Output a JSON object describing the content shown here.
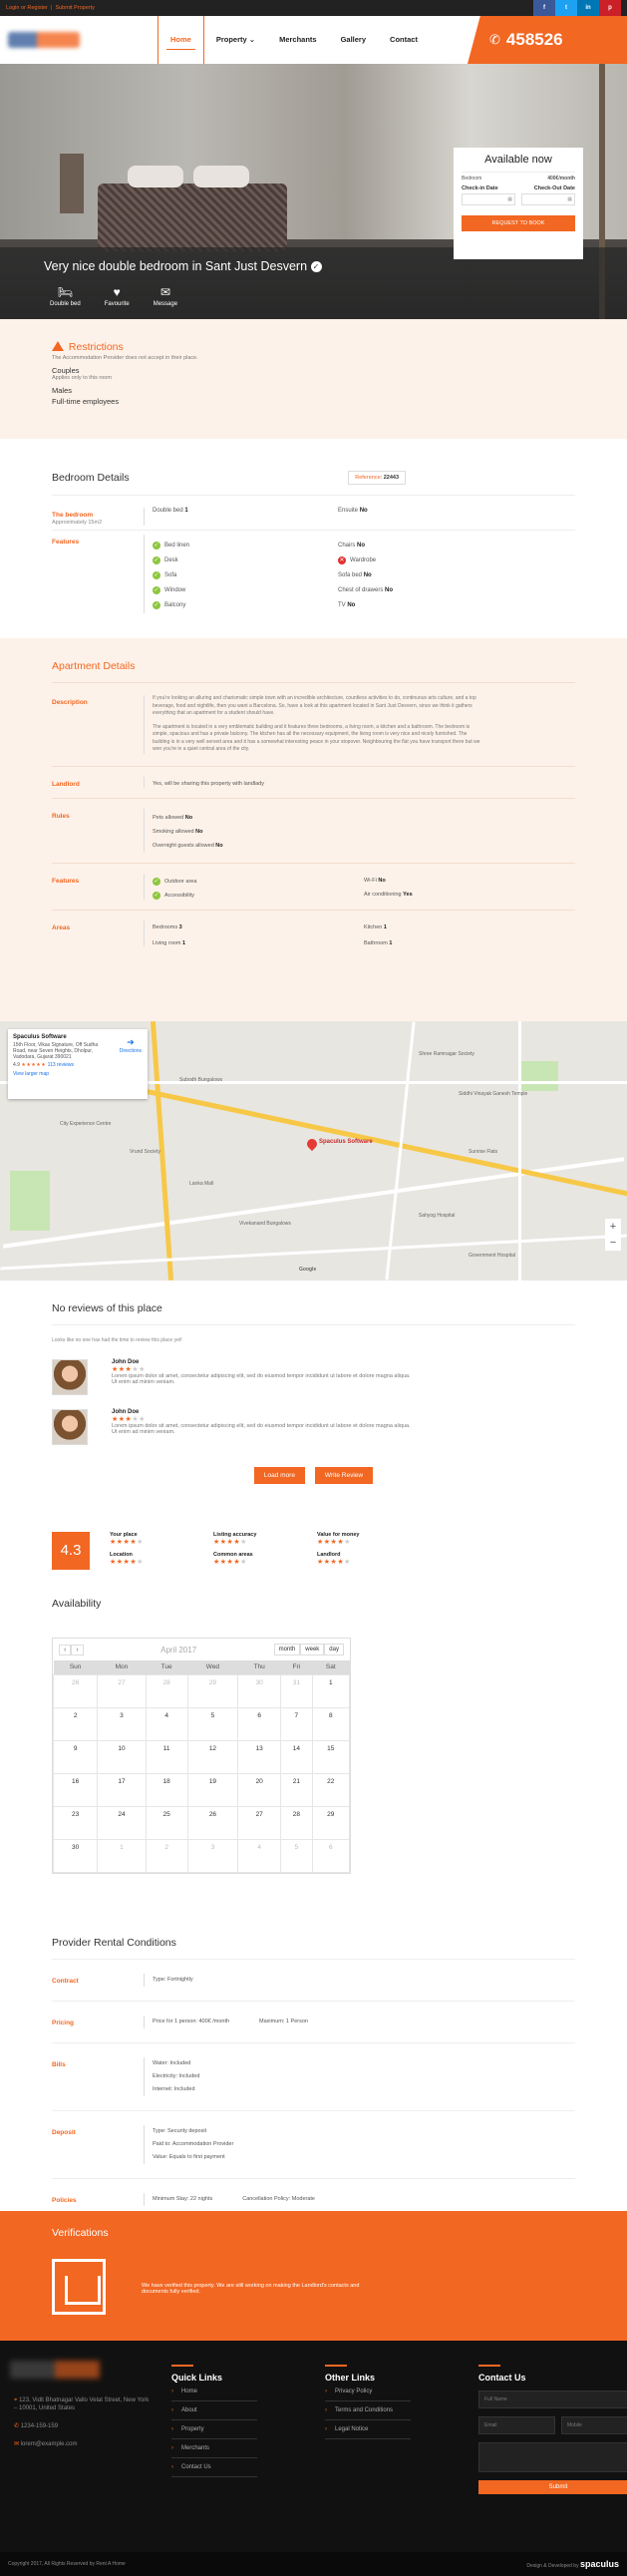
{
  "topbar": {
    "login": "Login or Register",
    "submit": "Submit Property",
    "social": [
      "f",
      "t",
      "in",
      "p"
    ]
  },
  "nav": {
    "items": [
      "Home",
      "Property",
      "Merchants",
      "Gallery",
      "Contact"
    ],
    "phone": "458526"
  },
  "hero": {
    "title": "Very nice double bedroom in Sant Just Desvern",
    "features": [
      "Double bed",
      "Favourite",
      "Message"
    ]
  },
  "booking": {
    "title": "Available now",
    "bedroom_label": "Bedroom",
    "price": "400€/month",
    "checkin": "Check-in Date",
    "checkout": "Check-Out Date",
    "button": "REQUEST TO BOOK"
  },
  "restrictions": {
    "title": "Restrictions",
    "note": "The Accommodation Provider does not accept in their place.",
    "items": [
      {
        "title": "Couples",
        "sub": "Applies only to this room"
      },
      {
        "title": "Males",
        "sub": ""
      },
      {
        "title": "Full-time employees",
        "sub": ""
      }
    ]
  },
  "bedroom": {
    "title": "Bedroom Details",
    "reference_label": "Reference",
    "reference": "22443",
    "room_label": "The bedroom",
    "room_sub": "Approximately 15m2",
    "bed_label": "Double bed",
    "bed_value": "1",
    "ensuite_label": "Ensuite",
    "ensuite_value": "No",
    "features_label": "Features",
    "features_left": [
      "Bed linen",
      "Desk",
      "Sofa",
      "Window",
      "Balcony"
    ],
    "features_right": [
      {
        "label": "Chairs",
        "value": "No",
        "state": "none"
      },
      {
        "label": "Wardrobe",
        "value": "",
        "state": "x"
      },
      {
        "label": "Sofa bed",
        "value": "No",
        "state": "none"
      },
      {
        "label": "Chest of drawers",
        "value": "No",
        "state": "none"
      },
      {
        "label": "TV",
        "value": "No",
        "state": "none"
      }
    ]
  },
  "apartment": {
    "title": "Apartment Details",
    "description_label": "Description",
    "description_1": "If you're looking an alluring and charismatic simple town with an incredible architecture, countless activities to do, continuous arts culture, and a top beverage, food and nightlife, then you want a Barcelona. So, have a look at this apartment located in Sant Just Desvern, since we think it gathers everything that an apartment for a student should have.",
    "description_2": "The apartment is located in a very emblematic building and it features three bedrooms, a living room, a kitchen and a bathroom. The bedroom is simple, spacious and has a private balcony. The kitchen has all the necessary equipment, the living room is very nice and nicely furnished. The building is in a very well served area and it has a somewhat interesting peace in your stopover. Neighbouring the flat you have transport there but we won you're in a quiet central area of the city.",
    "landlord_label": "Landlord",
    "landlord_value": "Yes, will be sharing this property with landlady",
    "rules_label": "Rules",
    "rules": [
      {
        "label": "Pets allowed",
        "value": "No"
      },
      {
        "label": "Smoking allowed",
        "value": "No"
      },
      {
        "label": "Overnight guests allowed",
        "value": "No"
      }
    ],
    "features_label": "Features",
    "features": [
      {
        "label": "Outdoor area",
        "value": "",
        "check": true
      },
      {
        "label": "Wi-Fi",
        "value": "No",
        "check": false
      },
      {
        "label": "Accessibility",
        "value": "",
        "check": true
      },
      {
        "label": "Air conditioning",
        "value": "Yes",
        "check": false
      }
    ],
    "areas_label": "Areas",
    "areas": [
      {
        "label": "Bedrooms",
        "value": "3"
      },
      {
        "label": "Kitchen",
        "value": "1"
      },
      {
        "label": "Living room",
        "value": "1"
      },
      {
        "label": "Bathroom",
        "value": "1"
      }
    ]
  },
  "map": {
    "place_name": "Spaculus Software",
    "place_addr": "15th Floor, Vikas Signature, Off Sudha Road, near Seven Heights, Dholpur, Vadodara, Gujarat 390021",
    "rating": "4.9",
    "reviews": "113 reviews",
    "view_larger": "View larger map",
    "directions": "Directions",
    "pin_label": "Spaculus Software",
    "labels": [
      "Subodh Bungalows",
      "Shree Ramnagar Society",
      "Siddhi Vinayak Ganesh Temple",
      "City Experience Centre",
      "Vrund Society",
      "Sunrise Flats",
      "Lanka Mall",
      "Sahyog Hospital",
      "Vivekanand Bungalows",
      "Government Hospital",
      "Google"
    ],
    "zoom_in": "+",
    "zoom_out": "−"
  },
  "reviews": {
    "title": "No reviews of this place",
    "note": "Looks like no one has had the time to review this place yet!",
    "items": [
      {
        "name": "John Doe",
        "text": "Lorem ipsum dolor sit amet, consectetur adipiscing elit, sed do eiusmod tempor incididunt ut labore et dolore magna aliqua. Ut enim ad minim veniam."
      },
      {
        "name": "John Doe",
        "text": "Lorem ipsum dolor sit amet, consectetur adipiscing elit, sed do eiusmod tempor incididunt ut labore et dolore magna aliqua. Ut enim ad minim veniam."
      }
    ],
    "load_more": "Load more",
    "write_review": "Write Review",
    "score": "4.3",
    "categories": [
      "Your place",
      "Listing accuracy",
      "Value for money",
      "Location",
      "Common areas",
      "Landlord"
    ]
  },
  "availability": {
    "title": "Availability",
    "month": "April 2017",
    "views": [
      "month",
      "week",
      "day"
    ],
    "days": [
      "Sun",
      "Mon",
      "Tue",
      "Wed",
      "Thu",
      "Fri",
      "Sat"
    ],
    "weeks": [
      [
        "26",
        "27",
        "28",
        "29",
        "30",
        "31",
        "1"
      ],
      [
        "2",
        "3",
        "4",
        "5",
        "6",
        "7",
        "8"
      ],
      [
        "9",
        "10",
        "11",
        "12",
        "13",
        "14",
        "15"
      ],
      [
        "16",
        "17",
        "18",
        "19",
        "20",
        "21",
        "22"
      ],
      [
        "23",
        "24",
        "25",
        "26",
        "27",
        "28",
        "29"
      ],
      [
        "30",
        "1",
        "2",
        "3",
        "4",
        "5",
        "6"
      ]
    ]
  },
  "conditions": {
    "title": "Provider Rental Conditions",
    "rows": [
      {
        "label": "Contract",
        "lines": [
          "Type: Fortnightly"
        ]
      },
      {
        "label": "Pricing",
        "lines": [
          "Price for 1 person: 400€ /month",
          "Maximum: 1 Person"
        ]
      },
      {
        "label": "Bills",
        "lines": [
          "Water: Included",
          "Electricity: Included",
          "Internet: Included"
        ]
      },
      {
        "label": "Deposit",
        "lines": [
          "Type: Security deposit",
          "Paid to: Accommodation Provider",
          "Value: Equals to first payment"
        ]
      },
      {
        "label": "Policies",
        "lines": [
          "Minimum Stay: 22 nights",
          "Cancellation Policy: Moderate"
        ]
      }
    ]
  },
  "verifications": {
    "title": "Verifications",
    "text": "We have verified this property. We are still working on making the Landlord's contacts and documents fully verified."
  },
  "footer": {
    "address": "123, Vidit Bhatnagar Vallo Velat Street, New York – 10001, United States",
    "phone": "1234-159-159",
    "email": "lorem@example.com",
    "quick_links_title": "Quick Links",
    "quick_links": [
      "Home",
      "About",
      "Property",
      "Merchants",
      "Contact Us"
    ],
    "other_links_title": "Other Links",
    "other_links": [
      "Privacy Policy",
      "Terms and Conditions",
      "Legal Notice"
    ],
    "contact_title": "Contact Us",
    "name_ph": "Full Name",
    "email_ph": "Email",
    "mobile_ph": "Mobile",
    "submit": "Submit",
    "copyright": "Copyright 2017, All Rights Reserved by Rent A Home",
    "credit": "Design & Developed by",
    "brand": "spaculus"
  },
  "colors": {
    "accent": "#f26722",
    "dark": "#111111",
    "light_bg": "#fdf2e9"
  }
}
